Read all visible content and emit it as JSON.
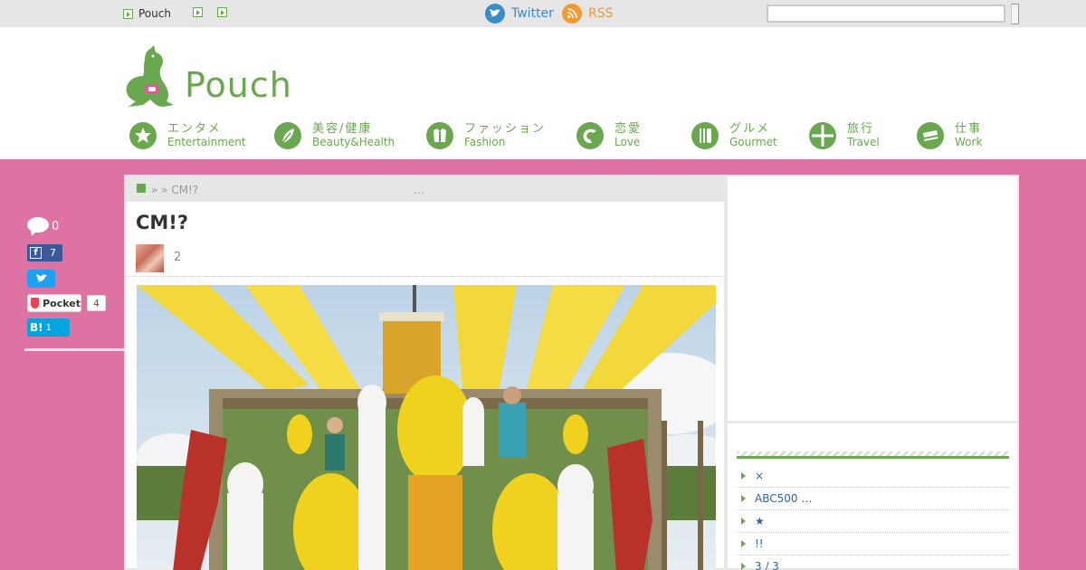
{
  "topbar": {
    "brand_link": "Pouch",
    "twitter_label": "Twitter",
    "rss_label": "RSS",
    "search": {
      "value": "",
      "placeholder": ""
    }
  },
  "header": {
    "logo_text": "Pouch",
    "nav": [
      {
        "jp": "エンタメ",
        "en": "Entertainment",
        "icon": "star-icon"
      },
      {
        "jp": "美容/健康",
        "en": "Beauty&Health",
        "icon": "leaf-icon"
      },
      {
        "jp": "ファッション",
        "en": "Fashion",
        "icon": "shirt-icon"
      },
      {
        "jp": "恋愛",
        "en": "Love",
        "icon": "heart-icon"
      },
      {
        "jp": "グルメ",
        "en": "Gourmet",
        "icon": "fork-knife-icon"
      },
      {
        "jp": "旅行",
        "en": "Travel",
        "icon": "globe-icon"
      },
      {
        "jp": "仕事",
        "en": "Work",
        "icon": "card-icon"
      }
    ],
    "accent_color": "#6aa84f"
  },
  "share": {
    "comments": "0",
    "facebook": "7",
    "pocket_label": "Pocket",
    "pocket": "4",
    "hatena_label": "B!",
    "hatena": "1"
  },
  "article": {
    "breadcrumb": "» » CM!?",
    "breadcrumb_tail": "…",
    "title": "CM!?",
    "author_count": "2"
  },
  "sidebar": {
    "heading": "",
    "items": [
      "×",
      "ABC500 …",
      "★",
      "!!",
      "3 / 3"
    ]
  }
}
